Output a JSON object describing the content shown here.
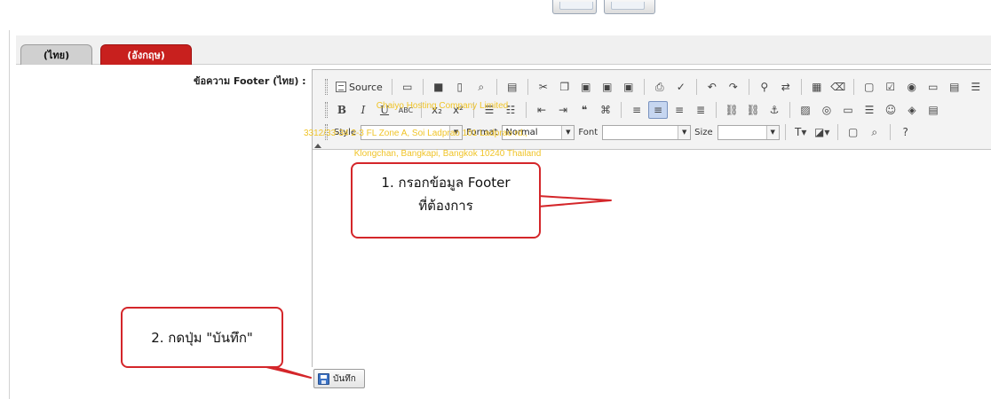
{
  "tabs": [
    {
      "label": "(ไทย)"
    },
    {
      "label": "(อังกฤษ)"
    }
  ],
  "form": {
    "field_label": "ข้อความ Footer (ไทย) :",
    "save_label": "บันทึก"
  },
  "editor": {
    "source_label": "Source",
    "style_label": "Style",
    "style_value": "",
    "format_label": "Format",
    "format_value": "Normal",
    "font_label": "Font",
    "font_value": "",
    "size_label": "Size",
    "size_value": "",
    "content_lines": [
      "Chaiyo Hosting Company Limited",
      "3312/33-34 2-3 FL Zone A, Soi Ladprao 101 Ladprao rd.,",
      "Klongchan, Bangkapi, Bangkok 10240 Thailand"
    ],
    "content_color": "#f0c428"
  },
  "annotations": {
    "step1_line1": "1. กรอกข้อมูล Footer",
    "step1_line2": "ที่ต้องการ",
    "step2": "2. กดปุ่ม \"บันทึก\"",
    "color": "#d4262a"
  },
  "colors": {
    "active_tab": "#d0d0d0",
    "inactive_tab": "#c8201e"
  }
}
